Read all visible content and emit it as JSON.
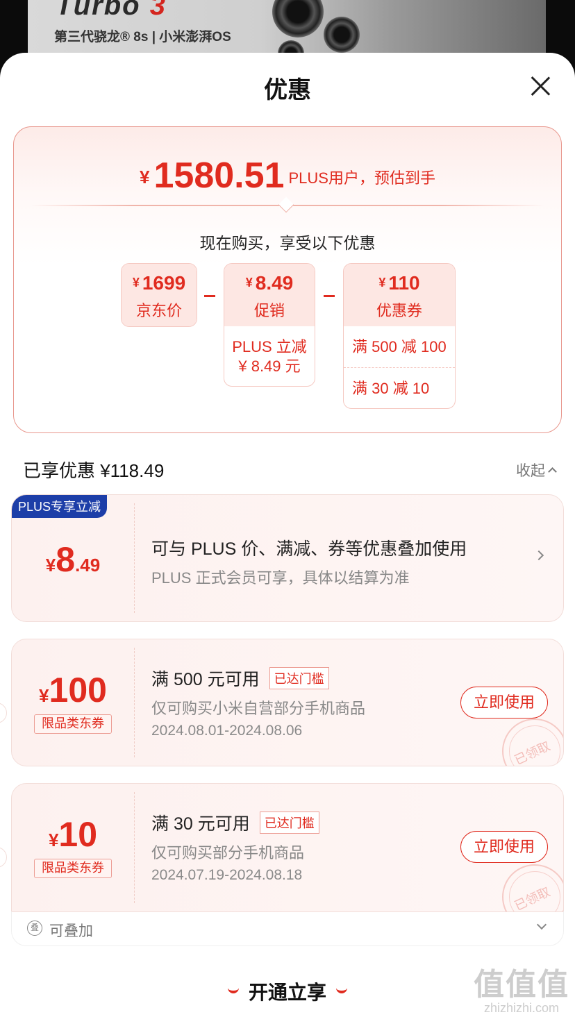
{
  "banner": {
    "title_main": "Turbo",
    "title_num": "3",
    "subtitle": "第三代骁龙® 8s | 小米澎湃OS"
  },
  "sheet": {
    "title": "优惠"
  },
  "summary": {
    "currency": "¥",
    "final_price": "1580.51",
    "final_note": "PLUS用户，预估到手",
    "buy_text": "现在购买，享受以下优惠",
    "jd_price": {
      "amount": "1699",
      "label": "京东价"
    },
    "promo": {
      "amount": "8.49",
      "label": "促销",
      "detail_line1": "PLUS 立减",
      "detail_line2": "¥ 8.49 元"
    },
    "coupon": {
      "amount": "110",
      "label": "优惠券",
      "rows": [
        "满 500 减 100",
        "满 30 减 10"
      ]
    }
  },
  "applied": {
    "label": "已享优惠 ¥118.49",
    "collapse": "收起"
  },
  "plus_card": {
    "tag": "PLUS专享立减",
    "yen": "¥",
    "amount_int": "8",
    "amount_dec": ".49",
    "title": "可与 PLUS 价、满减、券等优惠叠加使用",
    "sub": "PLUS 正式会员可享，具体以结算为准"
  },
  "coupons": [
    {
      "yen": "¥",
      "amount": "100",
      "tag": "限品类东券",
      "title": "满 500 元可用",
      "badge": "已达门槛",
      "sub": "仅可购买小米自营部分手机商品",
      "date": "2024.08.01-2024.08.06",
      "button": "立即使用",
      "stamp": "已领取"
    },
    {
      "yen": "¥",
      "amount": "10",
      "tag": "限品类东券",
      "title": "满 30 元可用",
      "badge": "已达门槛",
      "sub": "仅可购买部分手机商品",
      "date": "2024.07.19-2024.08.18",
      "button": "立即使用",
      "stamp": "已领取"
    }
  ],
  "stack": {
    "icon_glyph": "叠",
    "label": "可叠加"
  },
  "footer": {
    "open_now": "开通立享"
  },
  "watermark": {
    "logo": "值值值",
    "site": "zhizhizhi.com"
  },
  "colors": {
    "accent": "#e02b1f",
    "plus_blue": "#1d3ea8"
  }
}
